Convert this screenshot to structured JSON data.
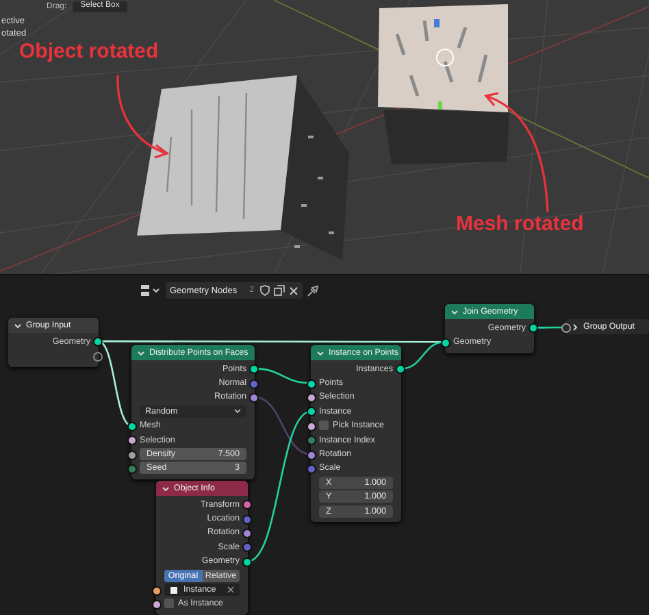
{
  "viewport": {
    "header": {
      "label": "Drag:",
      "dropdown": "Select Box"
    },
    "overlay_lines": [
      "ective",
      "otated"
    ],
    "annotations": [
      "Object rotated",
      "Mesh rotated"
    ]
  },
  "node_editor": {
    "header": {
      "tree_name": "Geometry Nodes",
      "users": "2"
    },
    "nodes": [
      {
        "title": "Group Input",
        "color": "#3a3a3a",
        "expanded": true,
        "rows": [
          {
            "kind": "output",
            "label": "Geometry",
            "color": "#00d6a3"
          },
          {
            "kind": "virtual"
          }
        ]
      },
      {
        "title": "Distribute Points on Faces",
        "color": "#1d7a5c",
        "expanded": true,
        "rows": [
          {
            "kind": "output",
            "label": "Points",
            "color": "#00d6a3"
          },
          {
            "kind": "output",
            "label": "Normal",
            "color": "#6363c7"
          },
          {
            "kind": "output",
            "label": "Rotation",
            "color": "#a385d8"
          },
          {
            "kind": "dropdown",
            "label": "Random"
          },
          {
            "kind": "input",
            "label": "Mesh",
            "color": "#00d6a3"
          },
          {
            "kind": "input",
            "label": "Selection",
            "color": "#cca6d6"
          },
          {
            "kind": "field",
            "label": "Density",
            "value": "7.500",
            "color": "#a1a1a1"
          },
          {
            "kind": "field",
            "label": "Seed",
            "value": "3",
            "color": "#35805c"
          }
        ]
      },
      {
        "title": "Instance on Points",
        "color": "#1d7a5c",
        "expanded": true,
        "rows": [
          {
            "kind": "output",
            "label": "Instances",
            "color": "#00d6a3"
          },
          {
            "kind": "input",
            "label": "Points",
            "color": "#00d6a3"
          },
          {
            "kind": "input",
            "label": "Selection",
            "color": "#cca6d6"
          },
          {
            "kind": "input",
            "label": "Instance",
            "color": "#00d6a3"
          },
          {
            "kind": "checkbox",
            "label": "Pick Instance",
            "checked": false,
            "color": "#cca6d6"
          },
          {
            "kind": "input",
            "label": "Instance Index",
            "color": "#35805c"
          },
          {
            "kind": "input",
            "label": "Rotation",
            "color": "#a385d8"
          },
          {
            "kind": "input",
            "label": "Scale",
            "color": "#6363c7"
          },
          {
            "kind": "vector_field",
            "label": "X",
            "value": "1.000"
          },
          {
            "kind": "vector_field",
            "label": "Y",
            "value": "1.000"
          },
          {
            "kind": "vector_field",
            "label": "Z",
            "value": "1.000"
          }
        ]
      },
      {
        "title": "Join Geometry",
        "color": "#1d7a5c",
        "expanded": true,
        "rows": [
          {
            "kind": "output",
            "label": "Geometry",
            "color": "#00d6a3"
          },
          {
            "kind": "input",
            "label": "Geometry",
            "color": "#00d6a3"
          }
        ]
      },
      {
        "title": "Group Output",
        "color": "#2a2a2a",
        "expanded": false
      },
      {
        "title": "Object Info",
        "color": "#8c2a48",
        "expanded": true,
        "rows": [
          {
            "kind": "output",
            "label": "Transform",
            "color": "#d860a8"
          },
          {
            "kind": "output",
            "label": "Location",
            "color": "#6363c7"
          },
          {
            "kind": "output",
            "label": "Rotation",
            "color": "#a385d8"
          },
          {
            "kind": "output",
            "label": "Scale",
            "color": "#6363c7"
          },
          {
            "kind": "output",
            "label": "Geometry",
            "color": "#00d6a3"
          },
          {
            "kind": "toggle",
            "options": [
              {
                "label": "Original",
                "selected": true
              },
              {
                "label": "Relative",
                "selected": false
              }
            ]
          },
          {
            "kind": "object",
            "label": "Instance",
            "color": "#ed9e5c"
          },
          {
            "kind": "checkbox",
            "label": "As Instance",
            "checked": false,
            "color": "#cca6d6"
          }
        ]
      }
    ]
  }
}
